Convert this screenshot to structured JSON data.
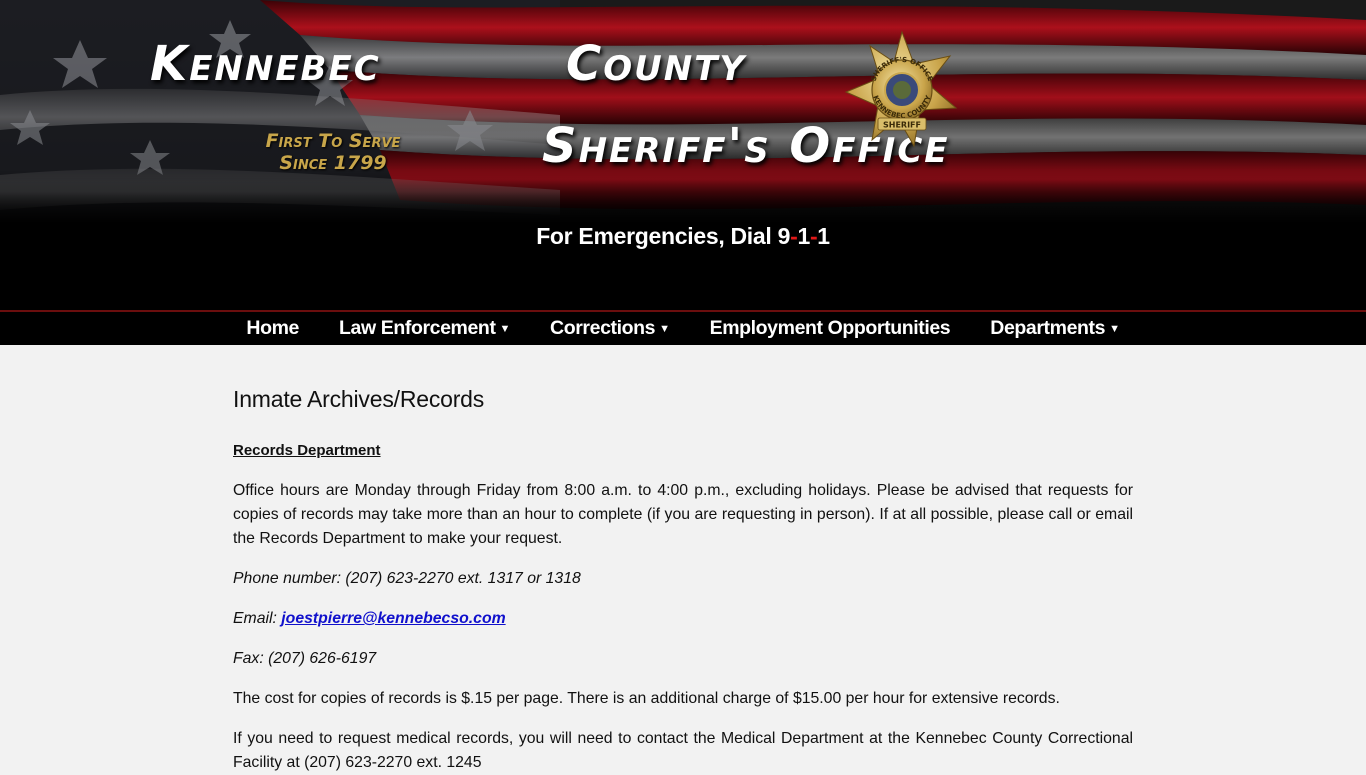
{
  "header": {
    "title_line1": "Kennebec",
    "title_line1b": "County",
    "title_line2": "Sheriff's Office",
    "motto_line1": "First To Serve",
    "motto_line2": "Since 1799",
    "badge_text_top": "SHERIFF'S OFFICE",
    "badge_text_bottom": "KENNEBEC COUNTY",
    "badge_banner": "SHERIFF",
    "emergency_prefix": "For Emergencies, Dial ",
    "emergency_d1": "9",
    "emergency_dash1": "-",
    "emergency_d2": "1",
    "emergency_dash2": "-",
    "emergency_d3": "1"
  },
  "nav": {
    "items": [
      {
        "label": "Home",
        "dropdown": false
      },
      {
        "label": "Law Enforcement",
        "dropdown": true
      },
      {
        "label": "Corrections",
        "dropdown": true
      },
      {
        "label": "Employment Opportunities",
        "dropdown": false
      },
      {
        "label": "Departments",
        "dropdown": true
      }
    ],
    "arrow": "▼"
  },
  "main": {
    "title": "Inmate Archives/Records",
    "section_heading": "Records Department",
    "hours_text": "Office hours are Monday through Friday from 8:00 a.m. to 4:00 p.m., excluding holidays. Please be advised that requests for copies of records may take more than an hour to complete (if you are requesting in person). If at all possible, please call or email the Records Department to make your request.",
    "phone_text": "Phone number: (207) 623-2270 ext. 1317 or 1318",
    "email_label": "Email: ",
    "email_link": "joestpierre@kennebecso.com",
    "fax_text": "Fax: (207) 626-6197",
    "cost_text": "The cost for copies of records is $.15 per page. There is an additional charge of $15.00 per hour for extensive records.",
    "medical_text": "If you need to request medical records, you will need to contact the Medical Department at the Kennebec County Correctional Facility at (207) 623-2270 ext. 1245"
  },
  "colors": {
    "accent_red": "#e01818",
    "motto_gold": "#c8a64a",
    "link_blue": "#1010cc",
    "nav_border": "#6b0e0e"
  }
}
